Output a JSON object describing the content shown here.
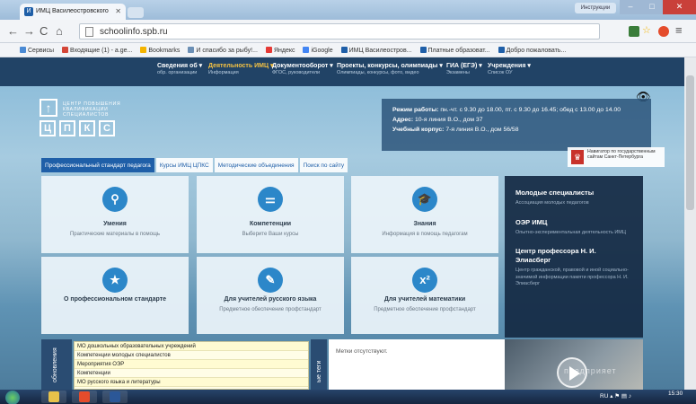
{
  "browser": {
    "tab_title": "ИМЦ Василеостровского",
    "url": "schoolinfo.spb.ru",
    "user_badge": "Инструкции"
  },
  "bookmarks": [
    {
      "label": "Сервисы",
      "color": "#4a8ad4"
    },
    {
      "label": "Входящие (1) - a.ge...",
      "color": "#d44638"
    },
    {
      "label": "Bookmarks",
      "color": "#f4b400"
    },
    {
      "label": "И спасибо за рыбу!...",
      "color": "#6b8fb5"
    },
    {
      "label": "Яндекс",
      "color": "#e53935"
    },
    {
      "label": "iGoogle",
      "color": "#4285f4"
    },
    {
      "label": "ИМЦ Василеостров...",
      "color": "#1f5fa8"
    },
    {
      "label": "Платные образоват...",
      "color": "#1f5fa8"
    },
    {
      "label": "Добро пожаловать...",
      "color": "#1f5fa8"
    }
  ],
  "topnav": [
    {
      "title": "Сведения об ▾",
      "sub": "обр. организации",
      "active": false
    },
    {
      "title": "Деятельность ИМЦ ▾",
      "sub": "Информация",
      "active": true
    },
    {
      "title": "Документооборот ▾",
      "sub": "ФГОС, руководители",
      "active": false
    },
    {
      "title": "Проекты, конкурсы, олимпиады ▾",
      "sub": "Олимпиады, конкурсы, фото, видео",
      "active": false
    },
    {
      "title": "ГИА (ЕГЭ) ▾",
      "sub": "Экзамены",
      "active": false
    },
    {
      "title": "Учреждения ▾",
      "sub": "Список ОУ",
      "active": false
    }
  ],
  "logo": {
    "text": "ЦЕНТР ПОВЫШЕНИЯ КВАЛИФИКАЦИИ СПЕЦИАЛИСТОВ",
    "letters": [
      "Ц",
      "П",
      "К",
      "С"
    ]
  },
  "hours": {
    "label1": "Режим работы:",
    "text1": "пн.-чт. с 9.30 до 18.00, пт. с 9.30 до 16.45; обед с 13.00 до 14.00",
    "label2": "Адрес:",
    "text2": "10-я линия В.О., дом 37",
    "label3": "Учебный корпус:",
    "text3": "7-я линия В.О., дом 56/58"
  },
  "navigator": {
    "text": "Навигатор по государственным сайтам Санкт-Петербурга"
  },
  "page_tabs": [
    {
      "label": "Профессиональный стандарт педагога",
      "active": true
    },
    {
      "label": "Курсы ИМЦ ЦПКС",
      "active": false
    },
    {
      "label": "Методические объединения",
      "active": false
    },
    {
      "label": "Поиск по сайту",
      "active": false
    }
  ],
  "tiles": [
    {
      "title": "Умения",
      "sub": "Практические материалы в помощь",
      "icon": "⚲"
    },
    {
      "title": "Компетенции",
      "sub": "Выберите Ваши курсы",
      "icon": "⚌"
    },
    {
      "title": "Знания",
      "sub": "Информация в помощь педагогам",
      "icon": "🎓"
    },
    {
      "title": "О профессиональном стандарте",
      "sub": "",
      "icon": "★"
    },
    {
      "title": "Для учителей русского языка",
      "sub": "Предметное обеспечение профстандарт",
      "icon": "✎"
    },
    {
      "title": "Для учителей математики",
      "sub": "Предметное обеспечение профстандарт",
      "icon": "x²"
    }
  ],
  "sidepanel": [
    {
      "title": "Молодые специалисты",
      "sub": "Ассоциация молодых педагогов"
    },
    {
      "title": "ОЭР ИМЦ",
      "sub": "Опытно-экспериментальная деятельность ИМЦ"
    },
    {
      "title": "Центр профессора Н. И. Элиасберг",
      "sub": "Центр гражданской, правовой и иной социально-значимой информации памяти профессора Н. И. Элиасберг"
    }
  ],
  "updates": {
    "heading": "обновления",
    "items": [
      "МО дошкольных образовательных учреждений",
      "Компетенции молодых специалистов",
      "Мероприятия ОЭР",
      "Компетенции",
      "МО русского языка и литературы"
    ]
  },
  "tags": {
    "heading": "ые теги",
    "text": "Метки отсутствуют."
  },
  "video": {
    "watermark": "предприяет"
  },
  "taskbar": {
    "lang": "RU",
    "time": "15:30",
    "apps": [
      "#e8c24a",
      "#e44c2c",
      "#2b5797"
    ]
  }
}
